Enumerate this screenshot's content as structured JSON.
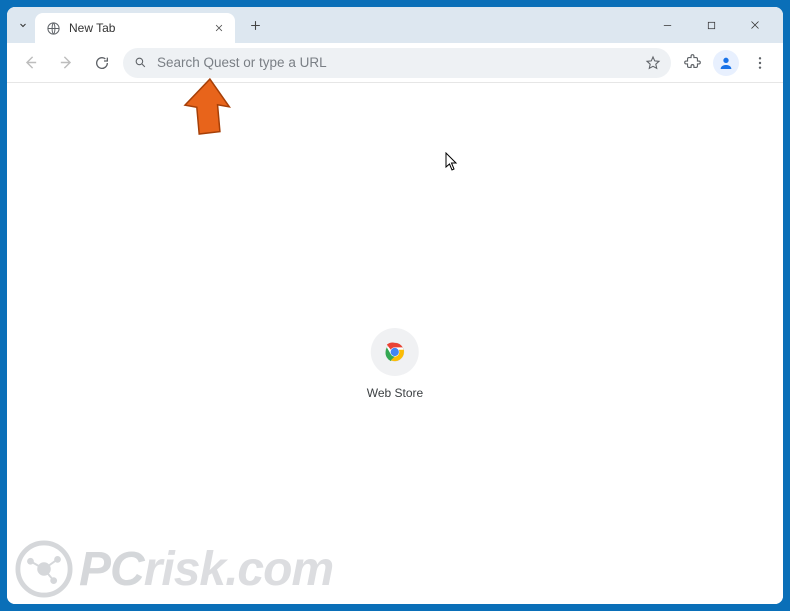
{
  "tab": {
    "title": "New Tab"
  },
  "omnibox": {
    "placeholder": "Search Quest or type a URL",
    "value": ""
  },
  "shortcut": {
    "label": "Web Store"
  },
  "watermark": {
    "text_pc": "PC",
    "text_risk": "risk.com"
  }
}
